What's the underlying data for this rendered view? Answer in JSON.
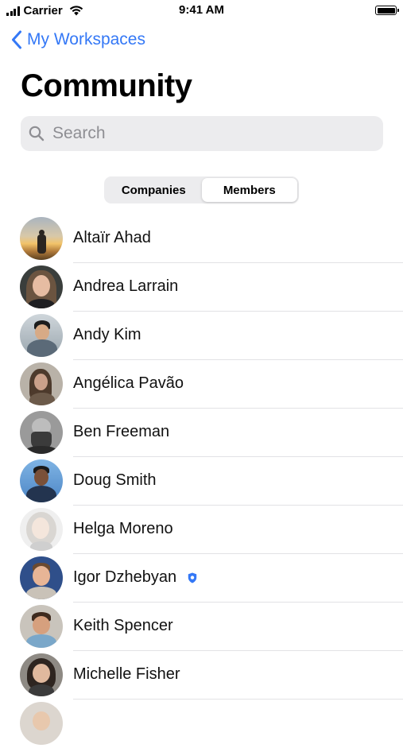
{
  "status_bar": {
    "carrier": "Carrier",
    "time": "9:41 AM"
  },
  "nav": {
    "back_label": "My Workspaces"
  },
  "page_title": "Community",
  "search": {
    "placeholder": "Search",
    "value": ""
  },
  "segments": [
    {
      "label": "Companies",
      "selected": false
    },
    {
      "label": "Members",
      "selected": true
    }
  ],
  "members": [
    {
      "name": "Altaïr Ahad"
    },
    {
      "name": "Andrea Larrain"
    },
    {
      "name": "Andy Kim"
    },
    {
      "name": "Angélica Pavão"
    },
    {
      "name": "Ben Freeman"
    },
    {
      "name": "Doug Smith"
    },
    {
      "name": "Helga Moreno"
    },
    {
      "name": "Igor Dzhebyan",
      "badge": "shield-icon"
    },
    {
      "name": "Keith Spencer"
    },
    {
      "name": "Michelle Fisher"
    }
  ],
  "colors": {
    "accent": "#3478f6",
    "search_bg": "#ececee",
    "divider": "#e2e2e5"
  }
}
